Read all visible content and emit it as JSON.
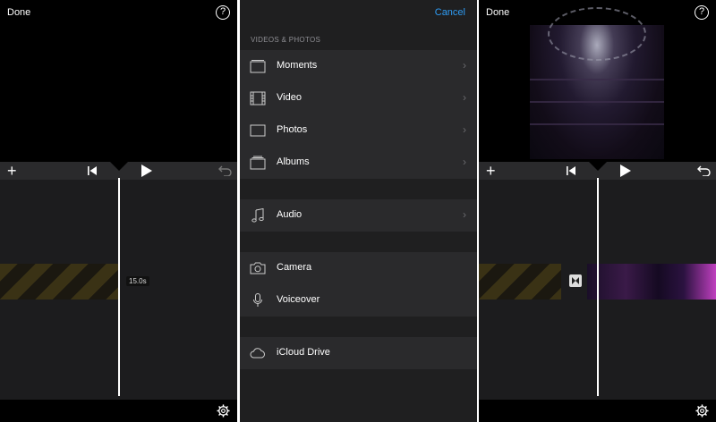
{
  "left_panel": {
    "done": "Done",
    "help": "?",
    "duration": "15.0s"
  },
  "import_panel": {
    "cancel": "Cancel",
    "section_title": "VIDEOS & PHOTOS",
    "media_items": [
      {
        "label": "Moments",
        "icon": "moments-icon"
      },
      {
        "label": "Video",
        "icon": "film-icon"
      },
      {
        "label": "Photos",
        "icon": "photo-icon"
      },
      {
        "label": "Albums",
        "icon": "album-icon"
      }
    ],
    "audio_items": [
      {
        "label": "Audio",
        "icon": "music-note-icon"
      }
    ],
    "capture_items": [
      {
        "label": "Camera",
        "icon": "camera-icon"
      },
      {
        "label": "Voiceover",
        "icon": "microphone-icon"
      }
    ],
    "cloud_items": [
      {
        "label": "iCloud Drive",
        "icon": "cloud-icon"
      }
    ]
  },
  "right_panel": {
    "done": "Done",
    "help": "?"
  },
  "colors": {
    "accent": "#2e9cf5",
    "background": "#000000",
    "list_background": "#2a2a2c"
  }
}
